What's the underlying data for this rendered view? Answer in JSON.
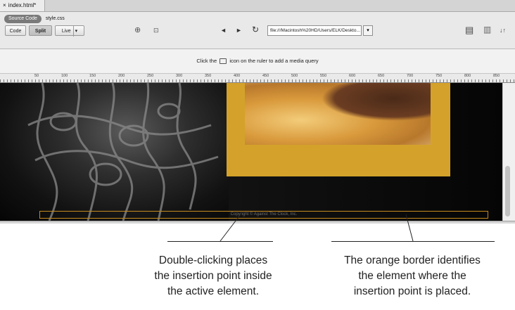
{
  "document_tab": {
    "close": "×",
    "title": "index.html*"
  },
  "related_files": {
    "source_code": "Source Code",
    "css_file": "style.css"
  },
  "view_buttons": {
    "code": "Code",
    "split": "Split",
    "live": "Live",
    "live_dropdown": "▾"
  },
  "toolbar_icons": {
    "inspect": "⊕",
    "viewport": "⊡",
    "back": "◄",
    "forward": "►",
    "refresh": "↻",
    "panel_icon": "▤",
    "layout_icon": "▥",
    "sort_icon": "↓↑"
  },
  "address_bar": {
    "value": "file:///Macintosh%20HD/Users/ELK/Deskto...",
    "dropdown": "▾"
  },
  "media_query": {
    "prefix": "Click the",
    "suffix": "icon on the ruler to add a media query"
  },
  "ruler_labels": [
    "50",
    "100",
    "150",
    "200",
    "250",
    "300",
    "350",
    "400",
    "450",
    "500",
    "550",
    "600",
    "650",
    "700",
    "750",
    "800",
    "850"
  ],
  "page_footer": "Copyright © Against The Clock, Inc.",
  "callouts": {
    "left": [
      "Double-clicking places",
      "the insertion point inside",
      "the active element."
    ],
    "right": [
      "The orange border identifies",
      "the element where the",
      "insertion point is placed."
    ]
  },
  "colors": {
    "orange_block": "#d4a22a",
    "selection_border": "#c58a1e",
    "page_background": "#050505"
  }
}
